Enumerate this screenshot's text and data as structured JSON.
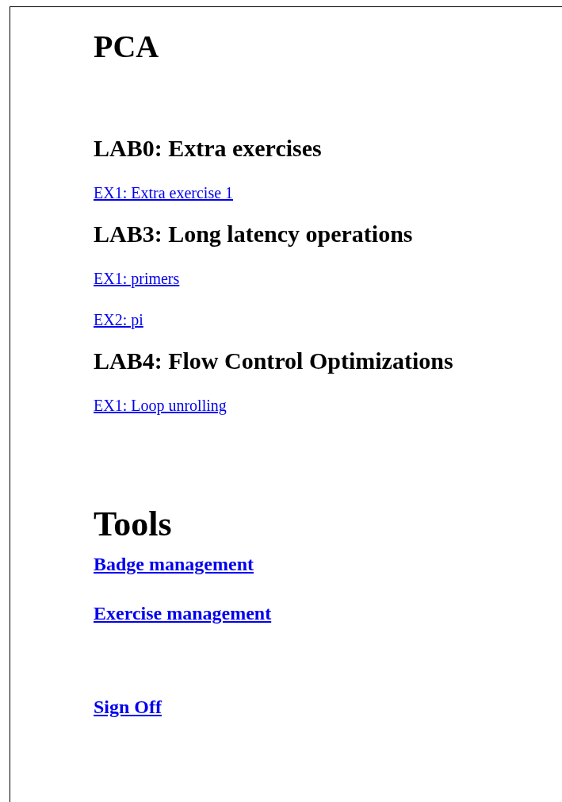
{
  "title": "PCA",
  "labs": [
    {
      "heading": "LAB0: Extra exercises",
      "exercises": [
        "EX1: Extra exercise 1"
      ]
    },
    {
      "heading": "LAB3: Long latency operations",
      "exercises": [
        "EX1: primers",
        "EX2: pi"
      ]
    },
    {
      "heading": "LAB4: Flow Control Optimizations",
      "exercises": [
        "EX1: Loop unrolling"
      ]
    }
  ],
  "tools": {
    "heading": "Tools",
    "links": [
      "Badge management",
      "Exercise management"
    ]
  },
  "sign_off": "Sign Off"
}
